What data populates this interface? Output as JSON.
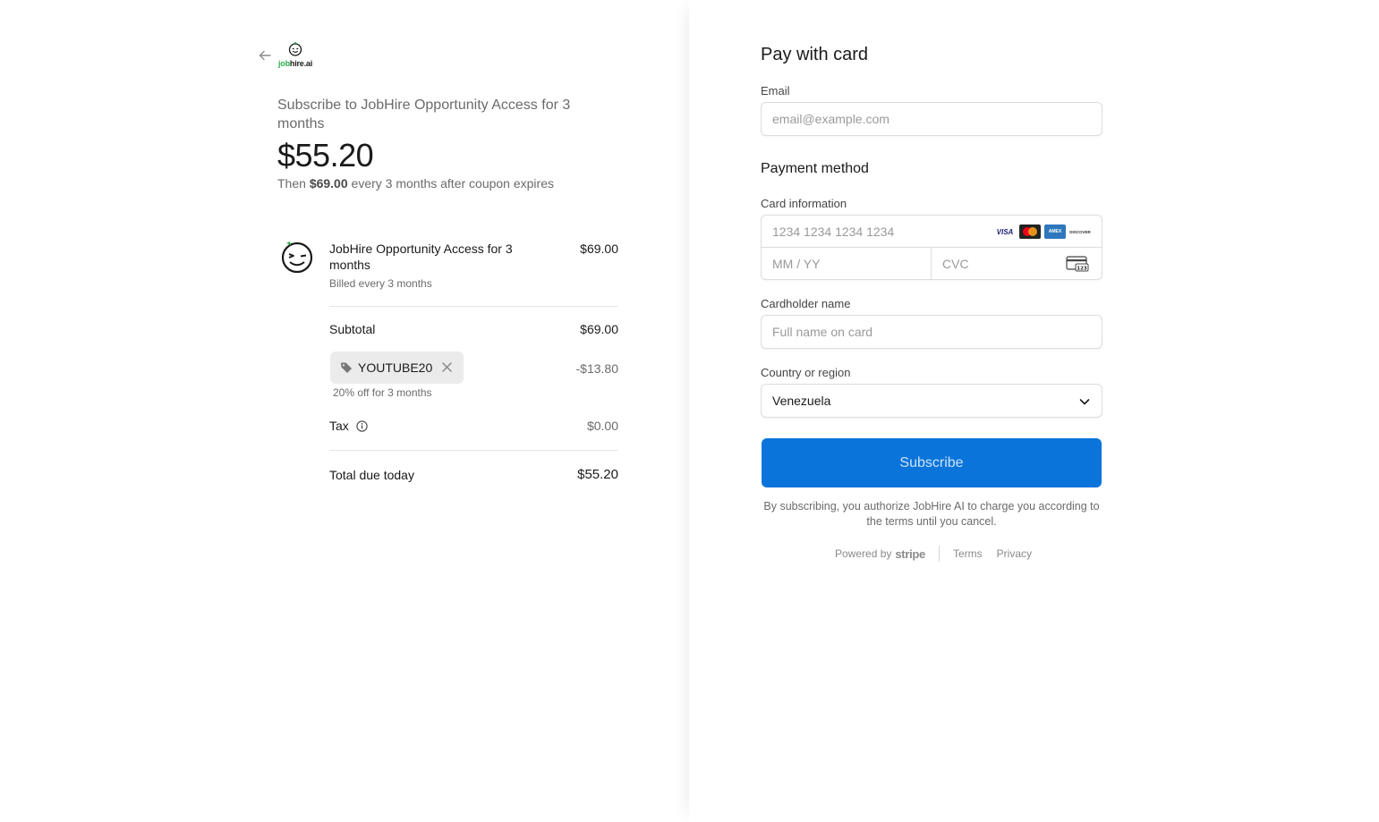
{
  "brand": {
    "logo_text_green": "job",
    "logo_text_dark": "hire.ai"
  },
  "summary": {
    "subscribe_title": "Subscribe to JobHire Opportunity Access for 3 months",
    "price": "$55.20",
    "then_prefix": "Then ",
    "then_amount": "$69.00",
    "then_suffix": " every 3 months after coupon expires"
  },
  "product": {
    "name": "JobHire Opportunity Access for 3 months",
    "billing": "Billed every 3 months",
    "price": "$69.00"
  },
  "totals": {
    "subtotal_label": "Subtotal",
    "subtotal_value": "$69.00",
    "coupon_code": "YOUTUBE20",
    "coupon_discount": "-$13.80",
    "coupon_note": "20% off for 3 months",
    "tax_label": "Tax",
    "tax_value": "$0.00",
    "total_label": "Total due today",
    "total_value": "$55.20"
  },
  "form": {
    "title": "Pay with card",
    "email_label": "Email",
    "email_placeholder": "email@example.com",
    "payment_method_label": "Payment method",
    "card_info_label": "Card information",
    "card_number_placeholder": "1234 1234 1234 1234",
    "expiry_placeholder": "MM / YY",
    "cvc_placeholder": "CVC",
    "card_brands": [
      "VISA",
      "Mastercard",
      "AMEX",
      "DISCOVER"
    ],
    "cardholder_label": "Cardholder name",
    "cardholder_placeholder": "Full name on card",
    "country_label": "Country or region",
    "country_value": "Venezuela",
    "subscribe_button": "Subscribe",
    "authorize_text": "By subscribing, you authorize JobHire AI to charge you according to the terms until you cancel."
  },
  "footer": {
    "powered_by": "Powered by",
    "stripe": "stripe",
    "terms": "Terms",
    "privacy": "Privacy"
  },
  "colors": {
    "accent": "#0a74da",
    "brand_green": "#2bb24c"
  }
}
